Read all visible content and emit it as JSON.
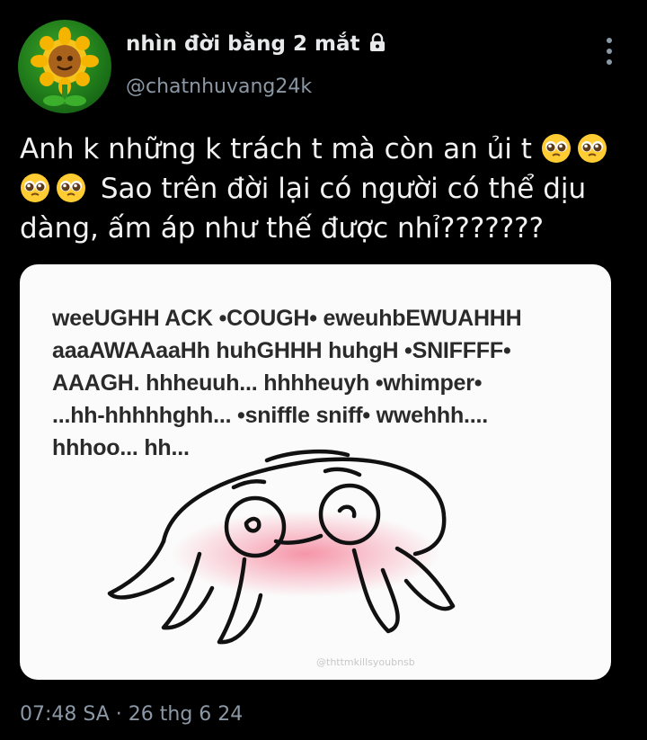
{
  "header": {
    "display_name": "nhìn đời bằng 2 mắt",
    "handle": "@chatnhuvang24k",
    "lock_icon": "lock-icon",
    "more_icon": "vertical-ellipsis-icon"
  },
  "tweet": {
    "text_part1": "Anh k những k trách t mà còn an ủi t",
    "text_part2": "Sao trên đời lại có người có thể dịu dàng, ấm áp như thế được nhỉ???????",
    "emoji": "pleading-face-emoji"
  },
  "media": {
    "meme_text": "weeUGHH ACK •COUGH• eweuhbEWUAHHH\naaaAWAAaaHh huhGHHH huhgH •SNIFFFF•\nAAAGH. hhheuuh... hhhheuyh •whimper•\n...hh-hhhhhghh... •sniffle sniff• wwehhh....\nhhhoo... hh...",
    "watermark": "@thttmkillsyoubnsb",
    "background": "#fbfbfb"
  },
  "footer": {
    "timestamp": "07:48 SA · 26 thg 6 24"
  },
  "colors": {
    "background": "#000000",
    "text": "#e7e9ea",
    "secondary": "#8b98a5"
  }
}
